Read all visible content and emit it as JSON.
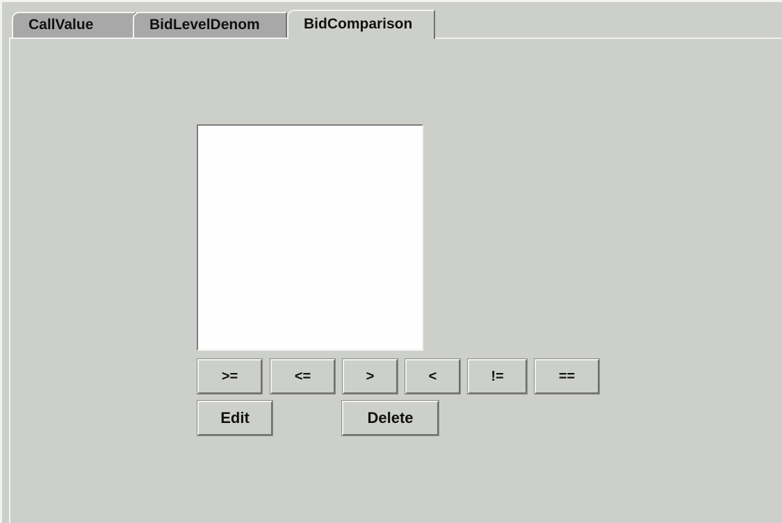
{
  "tabs": [
    {
      "label": "CallValue",
      "active": false
    },
    {
      "label": "BidLevelDenom",
      "active": false
    },
    {
      "label": "BidComparison",
      "active": true
    }
  ],
  "list": {
    "items": []
  },
  "operators": {
    "ge": ">=",
    "le": "<=",
    "gt": ">",
    "lt": "<",
    "ne": "!=",
    "eq": "=="
  },
  "actions": {
    "edit": "Edit",
    "delete": "Delete"
  },
  "colors": {
    "background": "#cdcfcb",
    "inactive_tab": "#a7a8a7",
    "list_background": "#fdfefd"
  }
}
